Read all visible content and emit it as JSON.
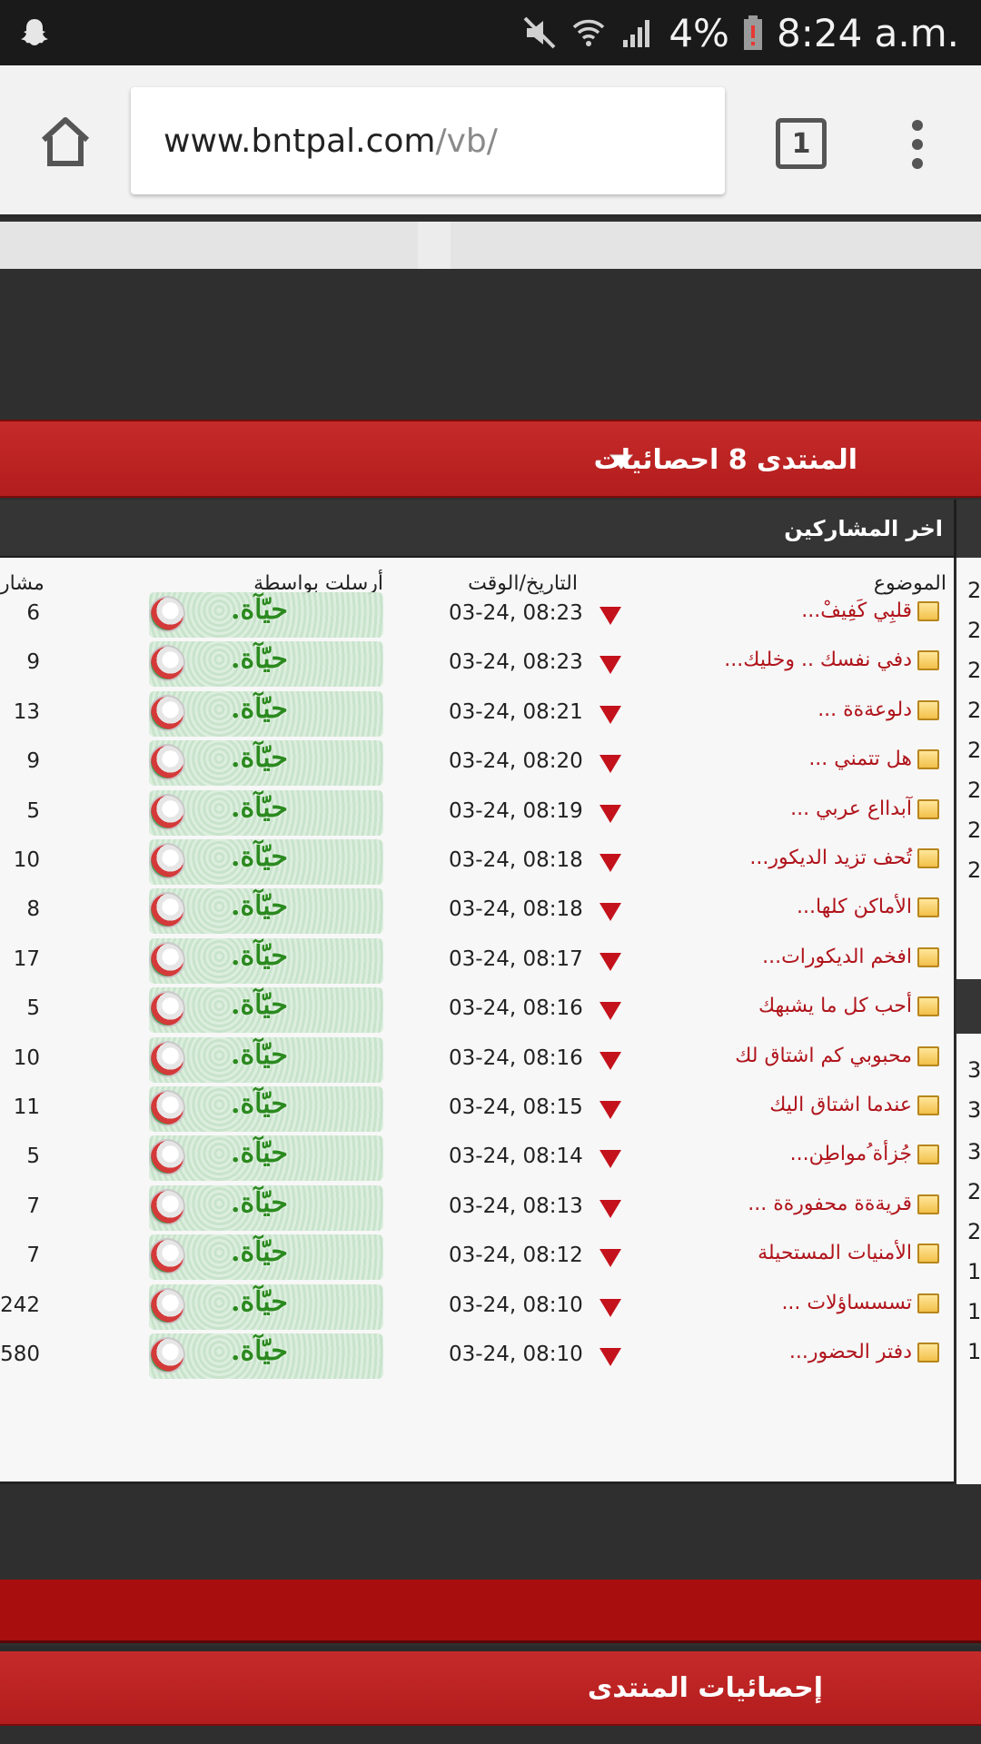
{
  "status_bar": {
    "battery": "4%",
    "time": "8:24 a.m.",
    "icons": [
      "snapchat-icon",
      "mute-icon",
      "wifi-icon",
      "signal-icon",
      "battery-alert-icon"
    ]
  },
  "browser": {
    "url_host": "www.bntpal.com",
    "url_path": "/vb/",
    "tab_count": "1"
  },
  "stats_header": {
    "title": "المنتدى 8 احصائيات"
  },
  "section": {
    "title": "اخر المشاركين"
  },
  "table": {
    "headers": {
      "topic": "الموضوع",
      "datetime": "التاريخ/الوقت",
      "sender": "أرسلت بواسطة",
      "posts": "مشار"
    },
    "rows": [
      {
        "topic": "قلبِي كَفِيفْ...",
        "datetime": "03-24, 08:23",
        "sender": "حيّآة.",
        "count": "6"
      },
      {
        "topic": "دفي نفسك .. وخليك...",
        "datetime": "03-24, 08:23",
        "sender": "حيّآة.",
        "count": "9"
      },
      {
        "topic": "دلوعةةة ...",
        "datetime": "03-24, 08:21",
        "sender": "حيّآة.",
        "count": "13"
      },
      {
        "topic": "هل تتمني ...",
        "datetime": "03-24, 08:20",
        "sender": "حيّآة.",
        "count": "9"
      },
      {
        "topic": "آبدااع عربي ...",
        "datetime": "03-24, 08:19",
        "sender": "حيّآة.",
        "count": "5"
      },
      {
        "topic": "تُحف تزيد الديكور...",
        "datetime": "03-24, 08:18",
        "sender": "حيّآة.",
        "count": "10"
      },
      {
        "topic": "الأماكن كلها...",
        "datetime": "03-24, 08:18",
        "sender": "حيّآة.",
        "count": "8"
      },
      {
        "topic": "افخم الديكورات...",
        "datetime": "03-24, 08:17",
        "sender": "حيّآة.",
        "count": "17"
      },
      {
        "topic": "أحب كل ما يشبهك",
        "datetime": "03-24, 08:16",
        "sender": "حيّآة.",
        "count": "5"
      },
      {
        "topic": "محبوبي كم اشتاق لك",
        "datetime": "03-24, 08:16",
        "sender": "حيّآة.",
        "count": "10"
      },
      {
        "topic": "عندما اشتاق اليك",
        "datetime": "03-24, 08:15",
        "sender": "حيّآة.",
        "count": "11"
      },
      {
        "topic": "جُزأة ُمواطِن...",
        "datetime": "03-24, 08:14",
        "sender": "حيّآة.",
        "count": "5"
      },
      {
        "topic": "قريةةة محفورةة ...",
        "datetime": "03-24, 08:13",
        "sender": "حيّآة.",
        "count": "7"
      },
      {
        "topic": "الأمنيات المستحيلة",
        "datetime": "03-24, 08:12",
        "sender": "حيّآة.",
        "count": "7"
      },
      {
        "topic": "تسسساؤلات ...",
        "datetime": "03-24, 08:10",
        "sender": "حيّآة.",
        "count": "242"
      },
      {
        "topic": "دفتر الحضور...",
        "datetime": "03-24, 08:10",
        "sender": "حيّآة.",
        "count": "580"
      }
    ]
  },
  "side_column": {
    "values": [
      "2",
      "2",
      "2",
      "2",
      "2",
      "2",
      "2",
      "2",
      "3",
      "3",
      "3",
      "2",
      "2",
      "1",
      "1",
      "1"
    ]
  },
  "footer": {
    "title": "إحصائيات المنتدى"
  }
}
